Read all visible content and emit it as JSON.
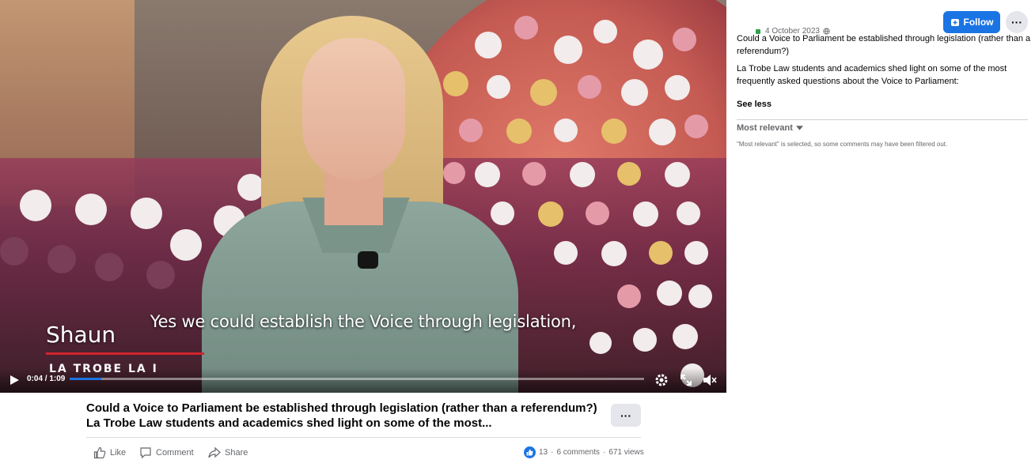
{
  "video": {
    "caption": "Yes we could establish the Voice through legislation,",
    "speaker_name": "Shaun",
    "brand_text": "LA TROBE LA I",
    "timecode": "0:04 / 1:09",
    "progress_fraction": 0.055
  },
  "post": {
    "title": "Could a Voice to Parliament be established through legislation (rather than a referendum?) La Trobe Law students and academics shed light on some of the most...",
    "more_label": "···",
    "actions": {
      "like": "Like",
      "comment": "Comment",
      "share": "Share"
    },
    "stats": {
      "reactions": "13",
      "comments": "6 comments",
      "views": "671 views",
      "separator": "·"
    }
  },
  "panel": {
    "follow_label": "Follow",
    "more_label": "···",
    "date": "4 October 2023",
    "paragraph1": "Could a Voice to Parliament be established through legislation (rather than a referendum?)",
    "paragraph2": "La Trobe Law students and academics shed light on some of the most frequently asked questions about the Voice to Parliament:",
    "see_less": "See less",
    "sort_label": "Most relevant",
    "filter_note": "\"Most relevant\" is selected, so some comments may have been filtered out."
  },
  "colors": {
    "accent": "#1b74e4",
    "caption_bar": "#d0262f",
    "muted_text": "#65676b"
  },
  "icons": [
    "play-icon",
    "settings-icon",
    "fullscreen-icon",
    "volume-icon",
    "like-icon",
    "comment-icon",
    "share-icon",
    "globe-icon",
    "follow-icon",
    "caret-down-icon"
  ]
}
